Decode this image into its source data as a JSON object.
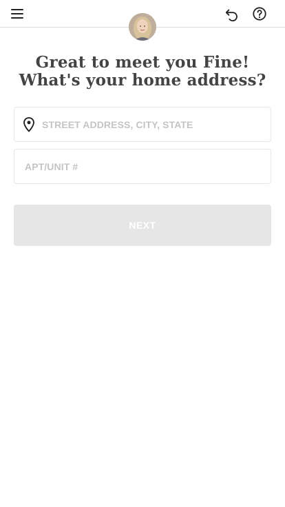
{
  "header": {
    "menu_icon": "hamburger-menu-icon",
    "avatar_icon": "user-avatar",
    "undo_icon": "undo-icon",
    "help_icon": "help-icon"
  },
  "main": {
    "title": "Great to meet you Fine! What's your home address?",
    "street_field": {
      "placeholder": "STREET ADDRESS, CITY, STATE",
      "value": "",
      "icon": "location-pin-icon"
    },
    "apt_field": {
      "placeholder": "APT/UNIT #",
      "value": ""
    },
    "next_label": "NEXT"
  },
  "colors": {
    "button_disabled": "#e6e6e6",
    "placeholder": "#c4c4c4",
    "title": "#444444"
  }
}
